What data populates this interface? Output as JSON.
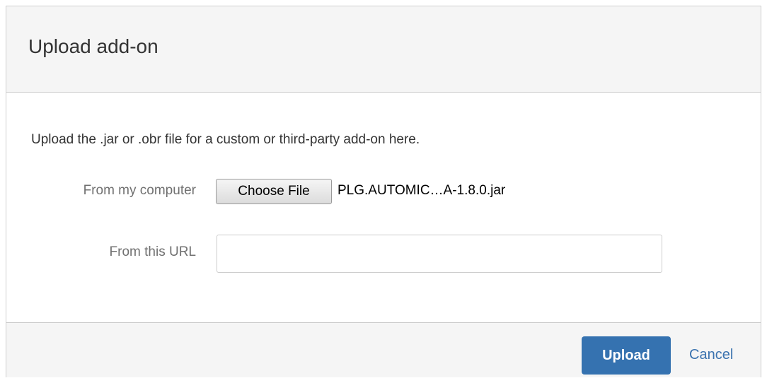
{
  "dialog": {
    "title": "Upload add-on",
    "description": "Upload the .jar or .obr file for a custom or third-party add-on here."
  },
  "form": {
    "computer_label": "From my computer",
    "choose_file_label": "Choose File",
    "selected_file_name": "PLG.AUTOMIC…A-1.8.0.jar",
    "url_label": "From this URL",
    "url_value": "",
    "url_placeholder": ""
  },
  "footer": {
    "upload_label": "Upload",
    "cancel_label": "Cancel"
  },
  "colors": {
    "primary_button": "#3572b0",
    "link": "#3b73af",
    "header_background": "#f5f5f5"
  }
}
